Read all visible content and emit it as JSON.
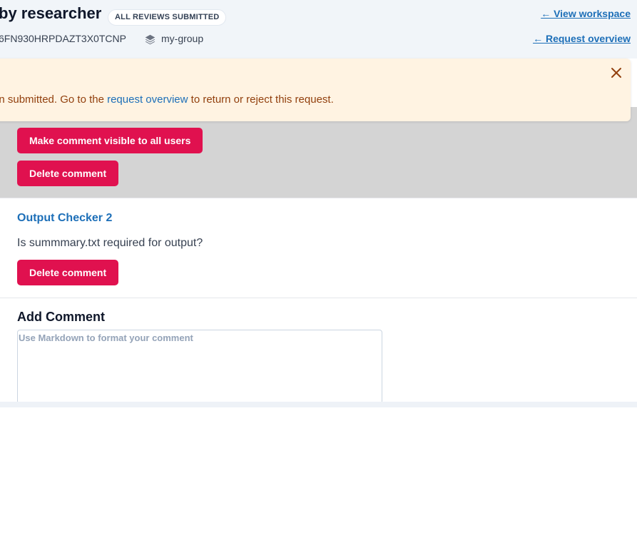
{
  "header": {
    "title": "by researcher",
    "status_badge": "ALL REVIEWS SUBMITTED",
    "request_id": "6FN930HRPDAZT3X0TCNP",
    "group": "my-group",
    "group_icon": "layers-icon",
    "links": {
      "view_workspace": "← View workspace",
      "request_overview": "← Request overview"
    }
  },
  "alert": {
    "text_before": "en submitted. Go to the ",
    "link_text": "request overview",
    "text_after": " to return or reject this request.",
    "close_icon": "close-icon"
  },
  "comments": [
    {
      "buttons": {
        "make_visible": "Make comment visible to all users",
        "delete": "Delete comment"
      }
    },
    {
      "author": "Output Checker 2",
      "body": "Is summmary.txt required for output?",
      "buttons": {
        "delete": "Delete comment"
      }
    }
  ],
  "add_comment": {
    "title": "Add Comment",
    "placeholder": "Use Markdown to format your comment",
    "value": ""
  },
  "colors": {
    "accent": "#e0114f",
    "link": "#1d6fb8",
    "alert_bg": "#fff3e2",
    "alert_text": "#92400e",
    "header_bg": "#f1f5f9"
  }
}
